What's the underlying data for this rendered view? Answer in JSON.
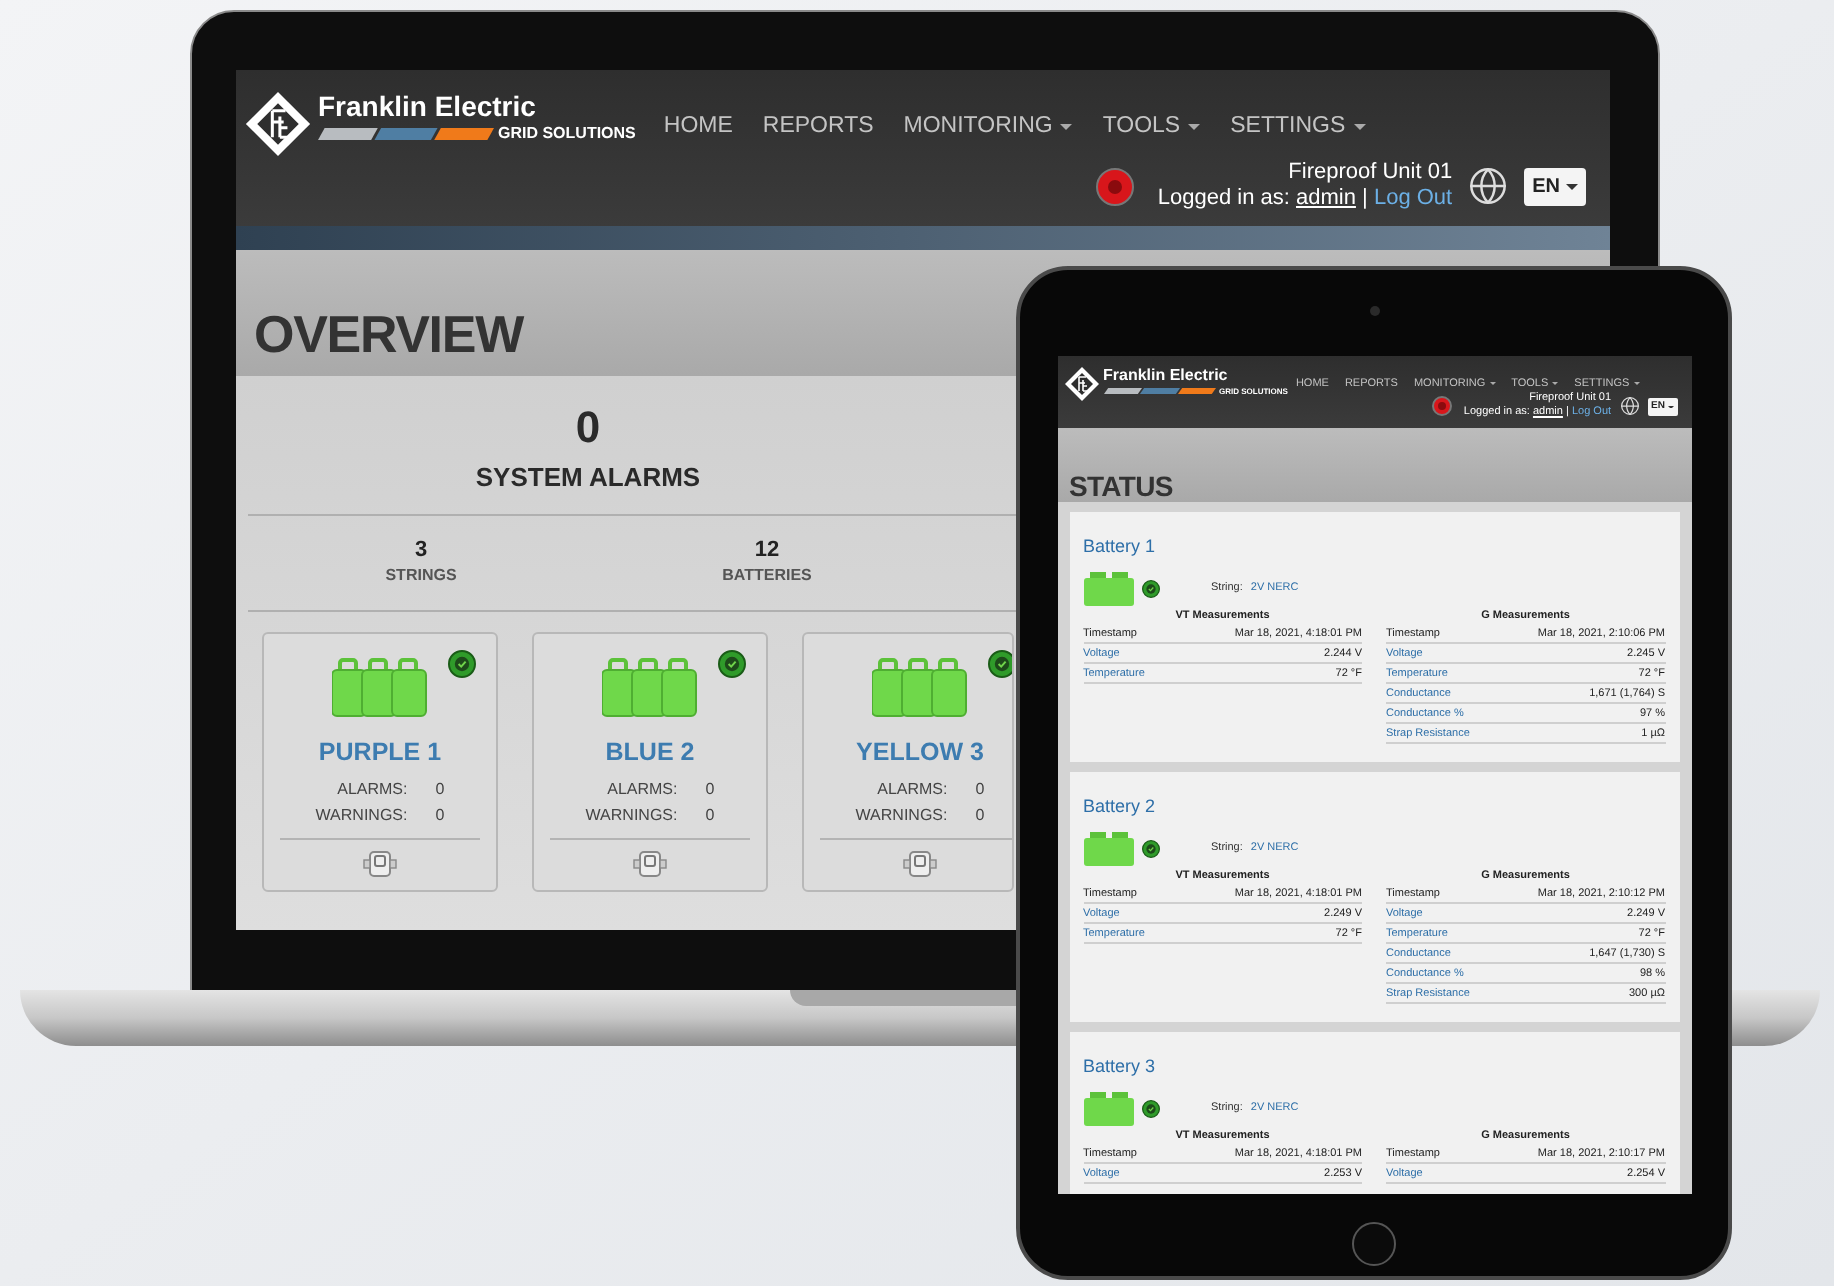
{
  "laptop": {
    "header": {
      "brand": "Franklin Electric",
      "tagline": "GRID SOLUTIONS",
      "nav": [
        {
          "label": "HOME",
          "dropdown": false
        },
        {
          "label": "REPORTS",
          "dropdown": false
        },
        {
          "label": "MONITORING",
          "dropdown": true
        },
        {
          "label": "TOOLS",
          "dropdown": true
        },
        {
          "label": "SETTINGS",
          "dropdown": true
        }
      ],
      "unit": "Fireproof Unit 01",
      "login_label": "Logged in as:",
      "user": "admin",
      "separator": "|",
      "logout": "Log Out",
      "language": "EN"
    },
    "page_title": "OVERVIEW",
    "system_alarms": {
      "count": "0",
      "label": "SYSTEM ALARMS"
    },
    "stats": [
      {
        "value": "3",
        "label": "STRINGS"
      },
      {
        "value": "12",
        "label": "BATTERIES"
      }
    ],
    "strings": [
      {
        "name": "PURPLE 1",
        "healthy": true,
        "alarms_label": "ALARMS:",
        "alarms": "0",
        "warnings_label": "WARNINGS:",
        "warnings": "0"
      },
      {
        "name": "BLUE 2",
        "healthy": true,
        "alarms_label": "ALARMS:",
        "alarms": "0",
        "warnings_label": "WARNINGS:",
        "warnings": "0"
      },
      {
        "name": "YELLOW 3",
        "healthy": true,
        "alarms_label": "ALARMS:",
        "alarms": "0",
        "warnings_label": "WARNINGS:",
        "warnings": "0"
      }
    ]
  },
  "tablet": {
    "header": {
      "brand": "Franklin Electric",
      "tagline": "GRID SOLUTIONS",
      "nav": [
        {
          "label": "HOME",
          "dropdown": false
        },
        {
          "label": "REPORTS",
          "dropdown": false
        },
        {
          "label": "MONITORING",
          "dropdown": true
        },
        {
          "label": "TOOLS",
          "dropdown": true
        },
        {
          "label": "SETTINGS",
          "dropdown": true
        }
      ],
      "unit": "Fireproof Unit 01",
      "login_label": "Logged in as:",
      "user": "admin",
      "separator": "|",
      "logout": "Log Out",
      "language": "EN"
    },
    "page_title": "STATUS",
    "batteries": [
      {
        "name": "Battery 1",
        "healthy": true,
        "string_label": "String:",
        "string": "2V NERC",
        "tables": [
          {
            "title": "VT Measurements",
            "rows": [
              {
                "label": "Timestamp",
                "linked": false,
                "value": "Mar 18, 2021, 4:18:01 PM"
              },
              {
                "label": "Voltage",
                "linked": true,
                "value": "2.244 V"
              },
              {
                "label": "Temperature",
                "linked": true,
                "value": "72 °F"
              }
            ]
          },
          {
            "title": "G Measurements",
            "rows": [
              {
                "label": "Timestamp",
                "linked": false,
                "value": "Mar 18, 2021, 2:10:06 PM"
              },
              {
                "label": "Voltage",
                "linked": true,
                "value": "2.245 V"
              },
              {
                "label": "Temperature",
                "linked": true,
                "value": "72 °F"
              },
              {
                "label": "Conductance",
                "linked": true,
                "value": "1,671 (1,764) S"
              },
              {
                "label": "Conductance %",
                "linked": true,
                "value": "97 %"
              },
              {
                "label": "Strap Resistance",
                "linked": true,
                "value": "1 µΩ"
              }
            ]
          }
        ]
      },
      {
        "name": "Battery 2",
        "healthy": true,
        "string_label": "String:",
        "string": "2V NERC",
        "tables": [
          {
            "title": "VT Measurements",
            "rows": [
              {
                "label": "Timestamp",
                "linked": false,
                "value": "Mar 18, 2021, 4:18:01 PM"
              },
              {
                "label": "Voltage",
                "linked": true,
                "value": "2.249 V"
              },
              {
                "label": "Temperature",
                "linked": true,
                "value": "72 °F"
              }
            ]
          },
          {
            "title": "G Measurements",
            "rows": [
              {
                "label": "Timestamp",
                "linked": false,
                "value": "Mar 18, 2021, 2:10:12 PM"
              },
              {
                "label": "Voltage",
                "linked": true,
                "value": "2.249 V"
              },
              {
                "label": "Temperature",
                "linked": true,
                "value": "72 °F"
              },
              {
                "label": "Conductance",
                "linked": true,
                "value": "1,647 (1,730) S"
              },
              {
                "label": "Conductance %",
                "linked": true,
                "value": "98 %"
              },
              {
                "label": "Strap Resistance",
                "linked": true,
                "value": "300 µΩ"
              }
            ]
          }
        ]
      },
      {
        "name": "Battery 3",
        "healthy": true,
        "string_label": "String:",
        "string": "2V NERC",
        "tables": [
          {
            "title": "VT Measurements",
            "rows": [
              {
                "label": "Timestamp",
                "linked": false,
                "value": "Mar 18, 2021, 4:18:01 PM"
              },
              {
                "label": "Voltage",
                "linked": true,
                "value": "2.253 V"
              }
            ]
          },
          {
            "title": "G Measurements",
            "rows": [
              {
                "label": "Timestamp",
                "linked": false,
                "value": "Mar 18, 2021, 2:10:17 PM"
              },
              {
                "label": "Voltage",
                "linked": true,
                "value": "2.254 V"
              }
            ]
          }
        ]
      }
    ]
  }
}
